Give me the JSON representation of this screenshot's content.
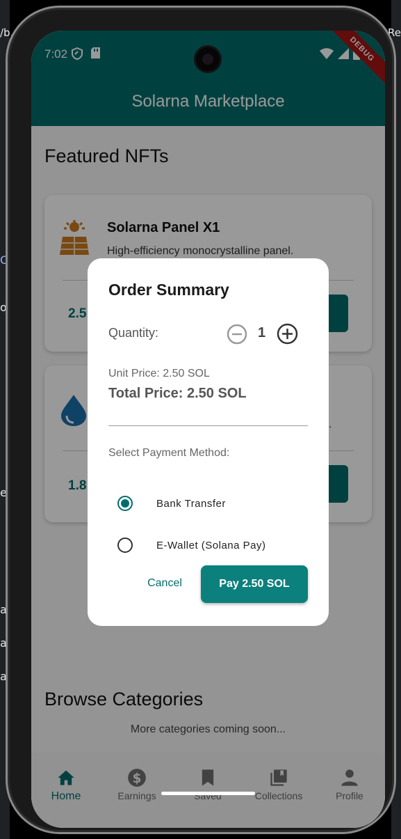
{
  "desktop_fragments": [
    "/b...",
    "Re",
    "Co",
    "oo",
    "el",
    "ay",
    "ar",
    "ai"
  ],
  "status_bar": {
    "time": "7:02",
    "debug_label": "DEBUG"
  },
  "app_bar": {
    "title": "Solarna Marketplace"
  },
  "featured": {
    "title": "Featured NFTs",
    "cards": [
      {
        "title": "Solarna Panel X1",
        "description": "High-efficiency monocrystalline panel.",
        "price_partial": "2.5",
        "icon": "solar-panel-icon"
      },
      {
        "title": "",
        "description": "e.",
        "price_partial": "1.8",
        "icon": "water-drop-icon"
      }
    ]
  },
  "browse": {
    "title": "Browse Categories",
    "subtitle": "More categories coming soon..."
  },
  "bottom_nav": [
    {
      "label": "Home",
      "icon": "home-icon",
      "active": true
    },
    {
      "label": "Earnings",
      "icon": "dollar-icon",
      "active": false
    },
    {
      "label": "Saved",
      "icon": "bookmark-icon",
      "active": false
    },
    {
      "label": "Collections",
      "icon": "collections-icon",
      "active": false
    },
    {
      "label": "Profile",
      "icon": "person-icon",
      "active": false
    }
  ],
  "dialog": {
    "title": "Order Summary",
    "quantity_label": "Quantity:",
    "quantity_value": "1",
    "unit_price": "Unit Price: 2.50 SOL",
    "total_price": "Total Price: 2.50 SOL",
    "payment_label": "Select Payment Method:",
    "payment_options": [
      {
        "label": "Bank Transfer",
        "selected": true
      },
      {
        "label": "E-Wallet (Solana Pay)",
        "selected": false
      }
    ],
    "cancel_label": "Cancel",
    "pay_label": "Pay 2.50 SOL"
  },
  "colors": {
    "primary": "#006d6b",
    "button": "#0c807d",
    "scrim": "rgba(0,0,0,0.4)"
  }
}
